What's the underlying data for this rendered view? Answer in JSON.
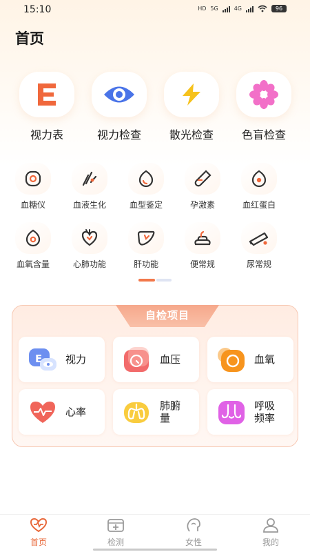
{
  "status": {
    "time": "15:10",
    "hd": "HD",
    "net1": "5G",
    "net2": "4G",
    "battery": "96"
  },
  "page": {
    "title": "首页"
  },
  "features": [
    {
      "label": "视力表",
      "icon": "letter-e-icon"
    },
    {
      "label": "视力检查",
      "icon": "eye-icon"
    },
    {
      "label": "散光检查",
      "icon": "lightning-icon"
    },
    {
      "label": "色盲检查",
      "icon": "flower-icon"
    }
  ],
  "grid": [
    {
      "label": "血糖仪",
      "icon": "glucose-meter-icon"
    },
    {
      "label": "血液生化",
      "icon": "blood-biochem-icon"
    },
    {
      "label": "血型鉴定",
      "icon": "blood-type-icon"
    },
    {
      "label": "孕激素",
      "icon": "test-tube-icon"
    },
    {
      "label": "血红蛋白",
      "icon": "hemoglobin-icon"
    },
    {
      "label": "血氧含量",
      "icon": "blood-oxygen-icon"
    },
    {
      "label": "心肺功能",
      "icon": "heart-lung-icon"
    },
    {
      "label": "肝功能",
      "icon": "liver-icon"
    },
    {
      "label": "便常规",
      "icon": "stool-icon"
    },
    {
      "label": "尿常规",
      "icon": "urine-icon"
    }
  ],
  "self_check": {
    "title": "自检项目",
    "items": [
      {
        "label": "视力",
        "icon": "vision-icon"
      },
      {
        "label": "血压",
        "icon": "blood-pressure-icon"
      },
      {
        "label": "血氧",
        "icon": "oxygen-icon"
      },
      {
        "label": "心率",
        "icon": "heart-rate-icon"
      },
      {
        "label": "肺腑量",
        "icon": "lungs-icon"
      },
      {
        "label": "呼吸频率",
        "icon": "breath-rate-icon"
      }
    ]
  },
  "nav": [
    {
      "label": "首页",
      "active": true
    },
    {
      "label": "检测",
      "active": false
    },
    {
      "label": "女性",
      "active": false
    },
    {
      "label": "我的",
      "active": false
    }
  ],
  "colors": {
    "accent": "#e8683a",
    "orange": "#f2784b",
    "blue": "#4a74e8",
    "pink": "#f270c8",
    "yellow": "#f6c21c"
  }
}
